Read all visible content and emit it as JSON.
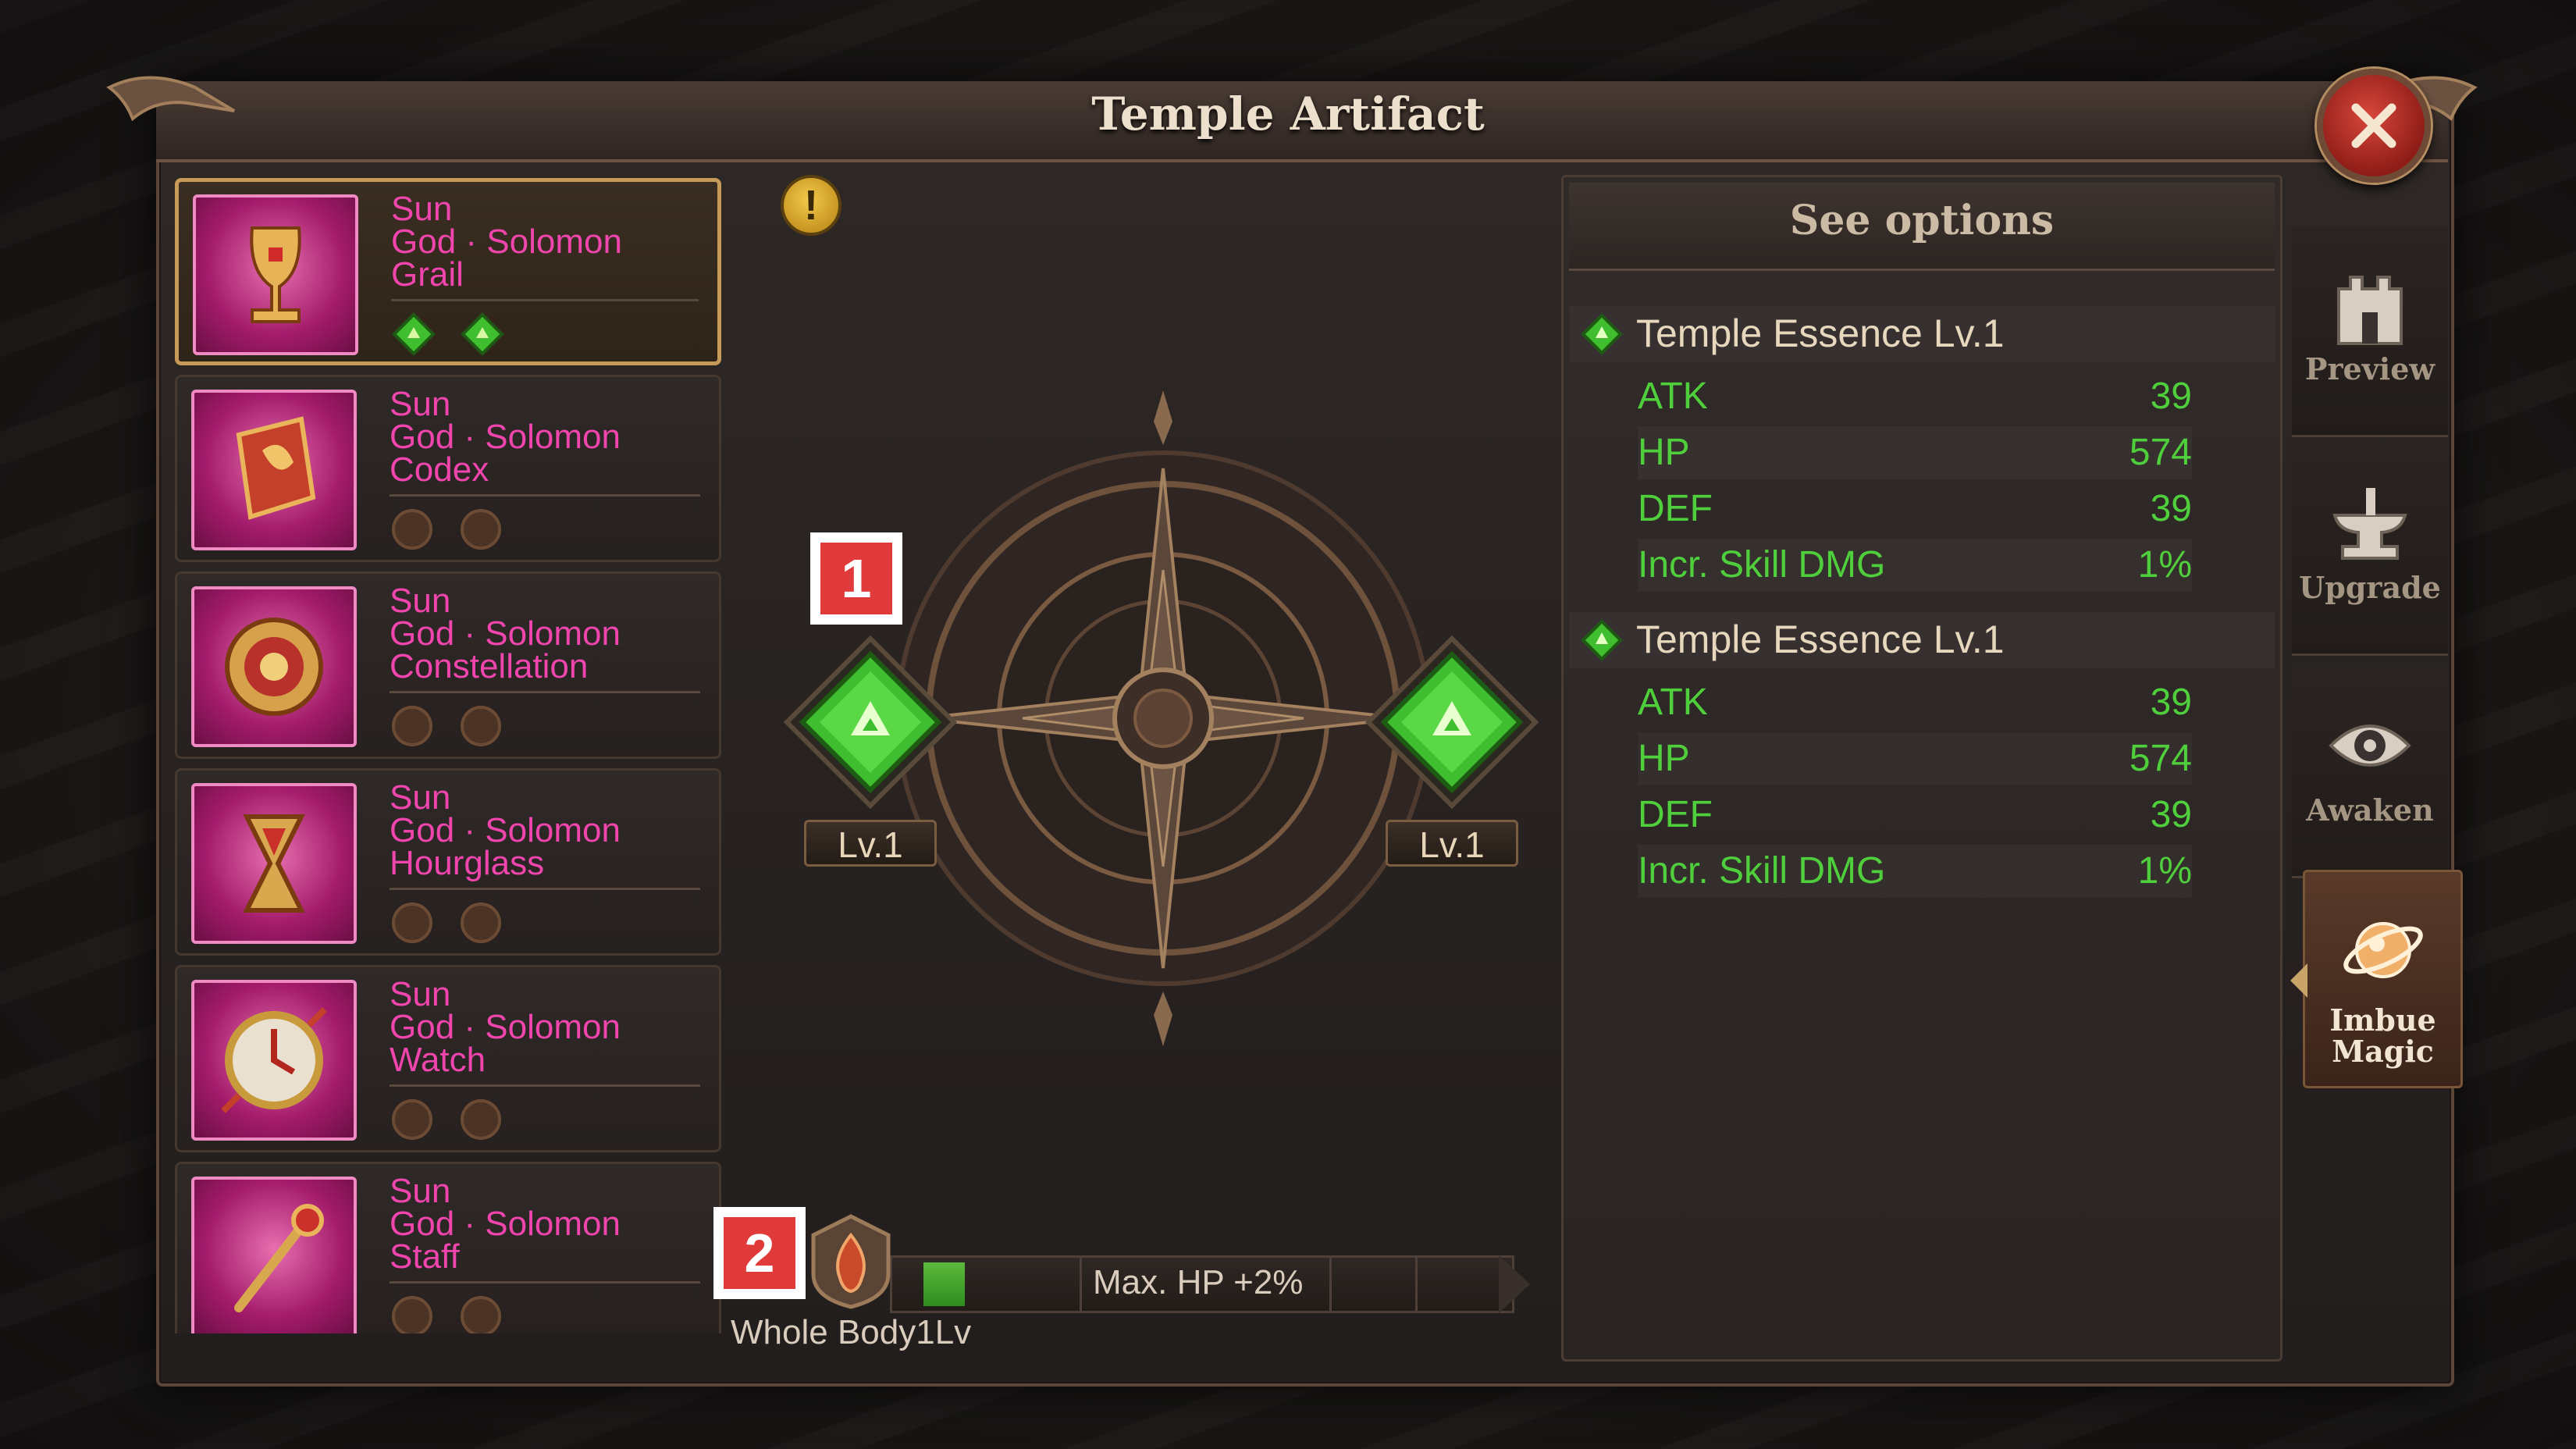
{
  "window": {
    "title": "Temple Artifact"
  },
  "artifacts": [
    {
      "name_lines": [
        "Sun",
        "God · Solomon",
        "Grail"
      ],
      "filled_slots": 2,
      "selected": true
    },
    {
      "name_lines": [
        "Sun",
        "God · Solomon",
        "Codex"
      ],
      "filled_slots": 0,
      "selected": false
    },
    {
      "name_lines": [
        "Sun",
        "God · Solomon",
        "Constellation"
      ],
      "filled_slots": 0,
      "selected": false
    },
    {
      "name_lines": [
        "Sun",
        "God · Solomon",
        "Hourglass"
      ],
      "filled_slots": 0,
      "selected": false
    },
    {
      "name_lines": [
        "Sun",
        "God · Solomon",
        "Watch"
      ],
      "filled_slots": 0,
      "selected": false
    },
    {
      "name_lines": [
        "Sun",
        "God · Solomon",
        "Staff"
      ],
      "filled_slots": 0,
      "selected": false
    }
  ],
  "center": {
    "info_icon": "exclamation-icon",
    "left_gem_level": "Lv.1",
    "right_gem_level": "Lv.1",
    "markers": [
      "1",
      "2"
    ]
  },
  "whole_body": {
    "label": "Whole Body1Lv",
    "bonus_text": "Max. HP +2%",
    "progress_fraction": 0.07
  },
  "options": {
    "title": "See options",
    "sections": [
      {
        "title": "Temple Essence Lv.1",
        "stats": [
          {
            "name": "ATK",
            "value": "39"
          },
          {
            "name": "HP",
            "value": "574"
          },
          {
            "name": "DEF",
            "value": "39"
          },
          {
            "name": "Incr. Skill DMG",
            "value": "1%"
          }
        ]
      },
      {
        "title": "Temple Essence Lv.1",
        "stats": [
          {
            "name": "ATK",
            "value": "39"
          },
          {
            "name": "HP",
            "value": "574"
          },
          {
            "name": "DEF",
            "value": "39"
          },
          {
            "name": "Incr. Skill DMG",
            "value": "1%"
          }
        ]
      }
    ]
  },
  "tabs": [
    {
      "label": "Preview",
      "icon": "castle-icon",
      "active": false
    },
    {
      "label": "Upgrade",
      "icon": "anvil-icon",
      "active": false
    },
    {
      "label": "Awaken",
      "icon": "eye-icon",
      "active": false
    },
    {
      "label": "Imbue Magic",
      "label_lines": [
        "Imbue",
        "Magic"
      ],
      "icon": "magic-orb-icon",
      "active": true
    }
  ],
  "colors": {
    "item_name": "#ef45ad",
    "stat_green": "#4fcf3c",
    "gem_green": "#3fbf2f",
    "close_red": "#c8352c",
    "marker_red": "#e03a3a"
  }
}
